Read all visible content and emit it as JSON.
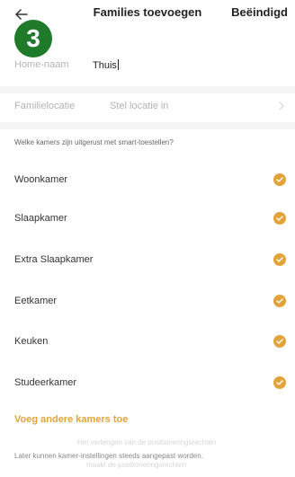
{
  "header": {
    "title": "Families toevoegen",
    "done_label": "Beëindigd",
    "back_icon": "arrow-left-icon"
  },
  "step_badge": "3",
  "form": {
    "home_name_label": "Home-naam",
    "home_name_value": "Thuis",
    "location_label": "Familielocatie",
    "location_value": "Stel locatie in"
  },
  "rooms_question": "Welke kamers zijn uitgerust met smart-toestellen?",
  "rooms": [
    {
      "label": "Woonkamer",
      "checked": true
    },
    {
      "label": "Slaapkamer",
      "checked": true
    },
    {
      "label": "Extra Slaapkamer",
      "checked": true
    },
    {
      "label": "Eetkamer",
      "checked": true
    },
    {
      "label": "Keuken",
      "checked": true
    },
    {
      "label": "Studeerkamer",
      "checked": true
    }
  ],
  "add_rooms_label": "Voeg andere kamers toe",
  "footnote": "Later kunnen kamer-instellingen steeds aangepast worden.",
  "ghost_texts": [
    "Het verlengen van de positioneringsrechten",
    "maakt de positioneringsrechten"
  ],
  "colors": {
    "accent": "#e2a43a",
    "badge": "#1f7a2a"
  }
}
